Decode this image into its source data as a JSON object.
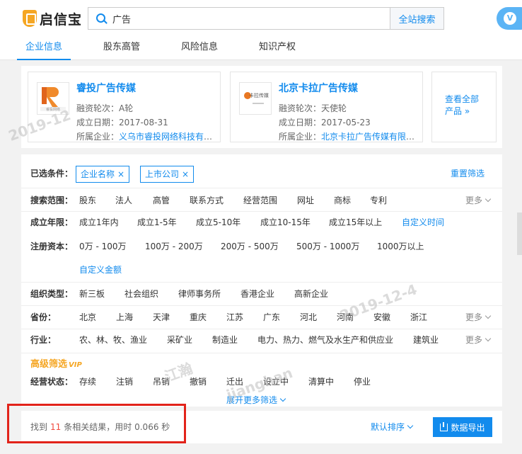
{
  "header": {
    "logo_text": "启信宝",
    "search_value": "广告",
    "search_button": "全站搜索"
  },
  "tabs": [
    "企业信息",
    "股东高管",
    "风险信息",
    "知识产权"
  ],
  "products": [
    {
      "logo_text": "睿投网络",
      "name": "睿投广告传媒",
      "round_label": "融资轮次：",
      "round": "A轮",
      "date_label": "成立日期：",
      "date": "2017-08-31",
      "company_label": "所属企业：",
      "company": "义乌市睿投网络科技有限..."
    },
    {
      "logo_text": "卡拉传媒",
      "name": "北京卡拉广告传媒",
      "round_label": "融资轮次：",
      "round": "天使轮",
      "date_label": "成立日期：",
      "date": "2017-05-23",
      "company_label": "所属企业：",
      "company": "北京卡拉广告传媒有限公..."
    }
  ],
  "view_all": {
    "line1": "查看全部",
    "line2": "产品 »"
  },
  "filters": {
    "selected_label": "已选条件：",
    "selected": [
      "企业名称",
      "上市公司"
    ],
    "chip_close": "×",
    "reset": "重置筛选",
    "scope_label": "搜索范围：",
    "scope": [
      "股东",
      "法人",
      "高管",
      "联系方式",
      "经营范围",
      "网址",
      "商标",
      "专利"
    ],
    "more": "更多",
    "years_label": "成立年限：",
    "years": [
      "成立1年内",
      "成立1-5年",
      "成立5-10年",
      "成立10-15年",
      "成立15年以上"
    ],
    "years_custom": "自定义时间",
    "capital_label": "注册资本：",
    "capital": [
      "0万 - 100万",
      "100万 - 200万",
      "200万 - 500万",
      "500万 - 1000万",
      "1000万以上"
    ],
    "capital_custom": "自定义金额",
    "org_label": "组织类型：",
    "org": [
      "新三板",
      "社会组织",
      "律师事务所",
      "香港企业",
      "高新企业"
    ],
    "province_label": "省份：",
    "province": [
      "北京",
      "上海",
      "天津",
      "重庆",
      "江苏",
      "广东",
      "河北",
      "河南",
      "安徽",
      "浙江"
    ],
    "industry_label": "行业：",
    "industry": [
      "农、林、牧、渔业",
      "采矿业",
      "制造业",
      "电力、热力、燃气及水生产和供应业",
      "建筑业"
    ],
    "advanced_title": "高级筛选",
    "advanced_vip": "VIP",
    "status_label": "经营状态：",
    "status": [
      "存续",
      "注销",
      "吊销",
      "撤销",
      "迁出",
      "设立中",
      "清算中",
      "停业"
    ],
    "expand": "展开更多筛选"
  },
  "results": {
    "prefix": "找到",
    "count": "11",
    "suffix": "条相关结果，用时 0.066 秒",
    "sort": "默认排序",
    "export": "数据导出"
  },
  "watermarks": [
    "2019-12",
    "2019-12-4",
    "江瀚",
    "jianghan"
  ]
}
